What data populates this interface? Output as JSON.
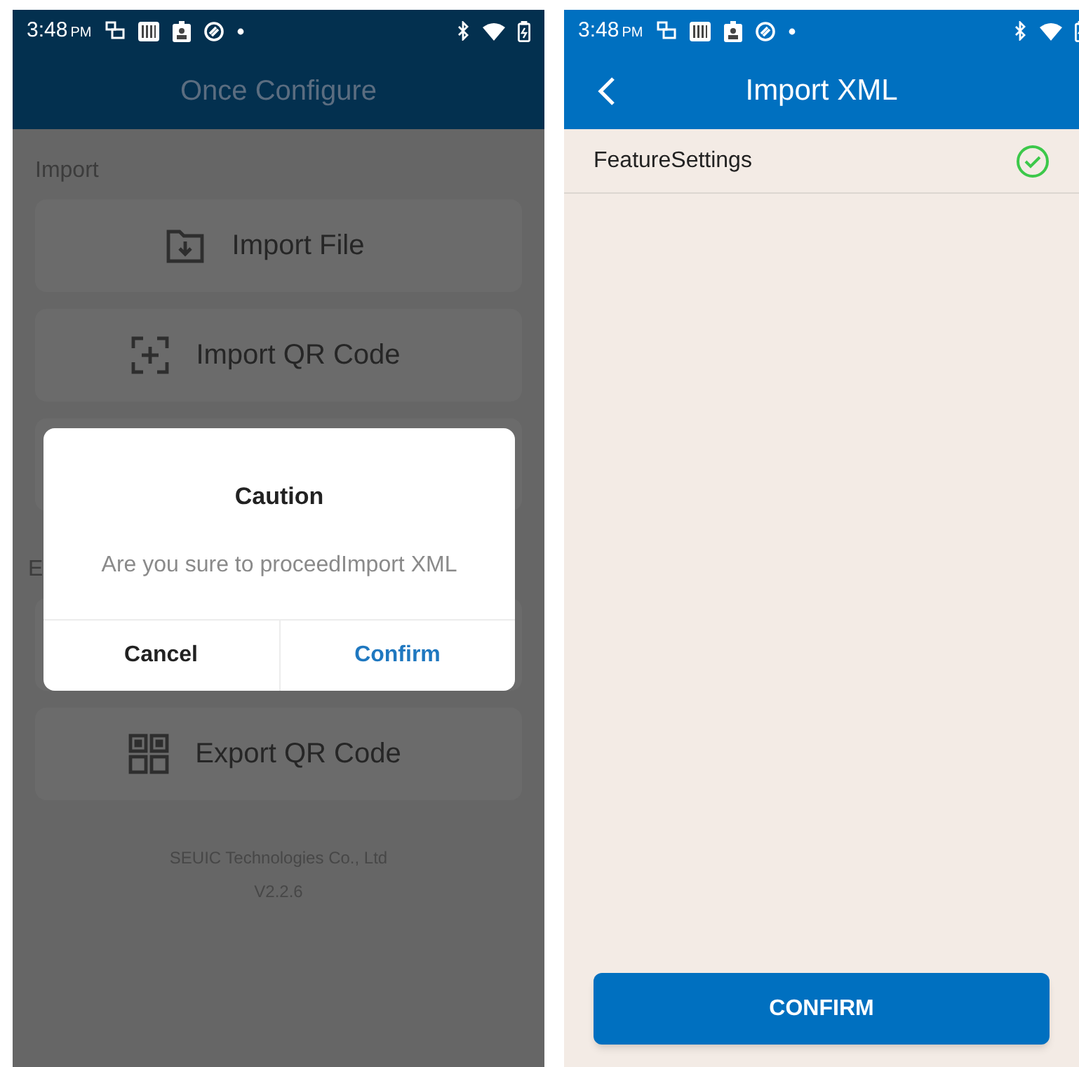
{
  "left_screen": {
    "status_bar": {
      "time": "3:48",
      "meridiem": "PM"
    },
    "title": "Once Configure",
    "content": [
      {
        "kind": "section",
        "label": "Import"
      },
      {
        "kind": "file-card",
        "label": "Import File"
      },
      {
        "kind": "scan-card",
        "label": "Import QR Code"
      },
      {
        "kind": "covered-card"
      },
      {
        "kind": "section",
        "label": "E"
      },
      {
        "kind": "covered-card"
      },
      {
        "kind": "grid-card",
        "label": "Export QR Code"
      }
    ],
    "footer": [
      "SEUIC Technologies Co., Ltd",
      "V2.2.6"
    ],
    "dialog": {
      "title": "Caution",
      "message": "Are you sure to proceedImport XML",
      "buttons": [
        {
          "label": "Cancel",
          "primary": false
        },
        {
          "label": "Confirm",
          "primary": true
        }
      ]
    }
  },
  "right_screen": {
    "status_bar": {
      "time": "3:48",
      "meridiem": "PM"
    },
    "title": "Import XML",
    "items": [
      {
        "label": "FeatureSettings",
        "checked": true
      }
    ],
    "button": "CONFIRM"
  }
}
